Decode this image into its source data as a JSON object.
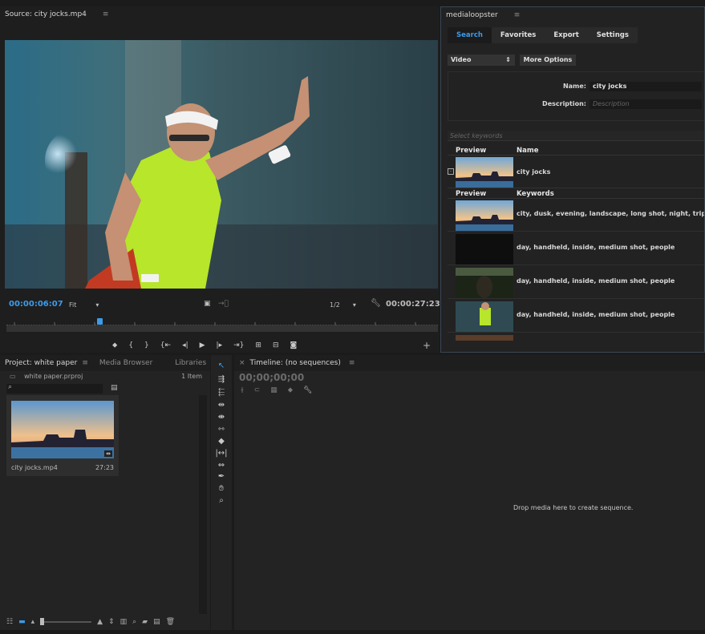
{
  "source": {
    "title": "Source: city jocks.mp4",
    "timecode_current": "00:00:06:07",
    "fit": "Fit",
    "resolution": "1/2",
    "timecode_duration": "00:00:27:23"
  },
  "medialoopster": {
    "title": "medialoopster",
    "tabs": [
      "Search",
      "Favorites",
      "Export",
      "Settings"
    ],
    "type_select": "Video",
    "more_options": "More Options",
    "name_label": "Name:",
    "name_value": "city jocks",
    "description_label": "Description:",
    "description_placeholder": "Description",
    "keywords_placeholder": "Select keywords",
    "preview_header": "Preview",
    "name_header": "Name",
    "result_name": "city jocks",
    "keywords_header": "Keywords",
    "keyword_rows": [
      "city, dusk, evening, landscape, long shot, night, tripod",
      "day, handheld, inside, medium shot, people",
      "day, handheld, inside, medium shot, people",
      "day, handheld, inside, medium shot, people"
    ]
  },
  "project": {
    "tabs": [
      "Project: white paper",
      "Media Browser",
      "Libraries"
    ],
    "file": "white paper.prproj",
    "item_count": "1 Item",
    "clip_name": "city jocks.mp4",
    "clip_duration": "27:23"
  },
  "timeline": {
    "title": "Timeline: (no sequences)",
    "timecode": "00;00;00;00",
    "drop_text": "Drop media here to create sequence."
  },
  "colors": {
    "accent": "#3d9be9",
    "panel_bg": "#232323"
  }
}
